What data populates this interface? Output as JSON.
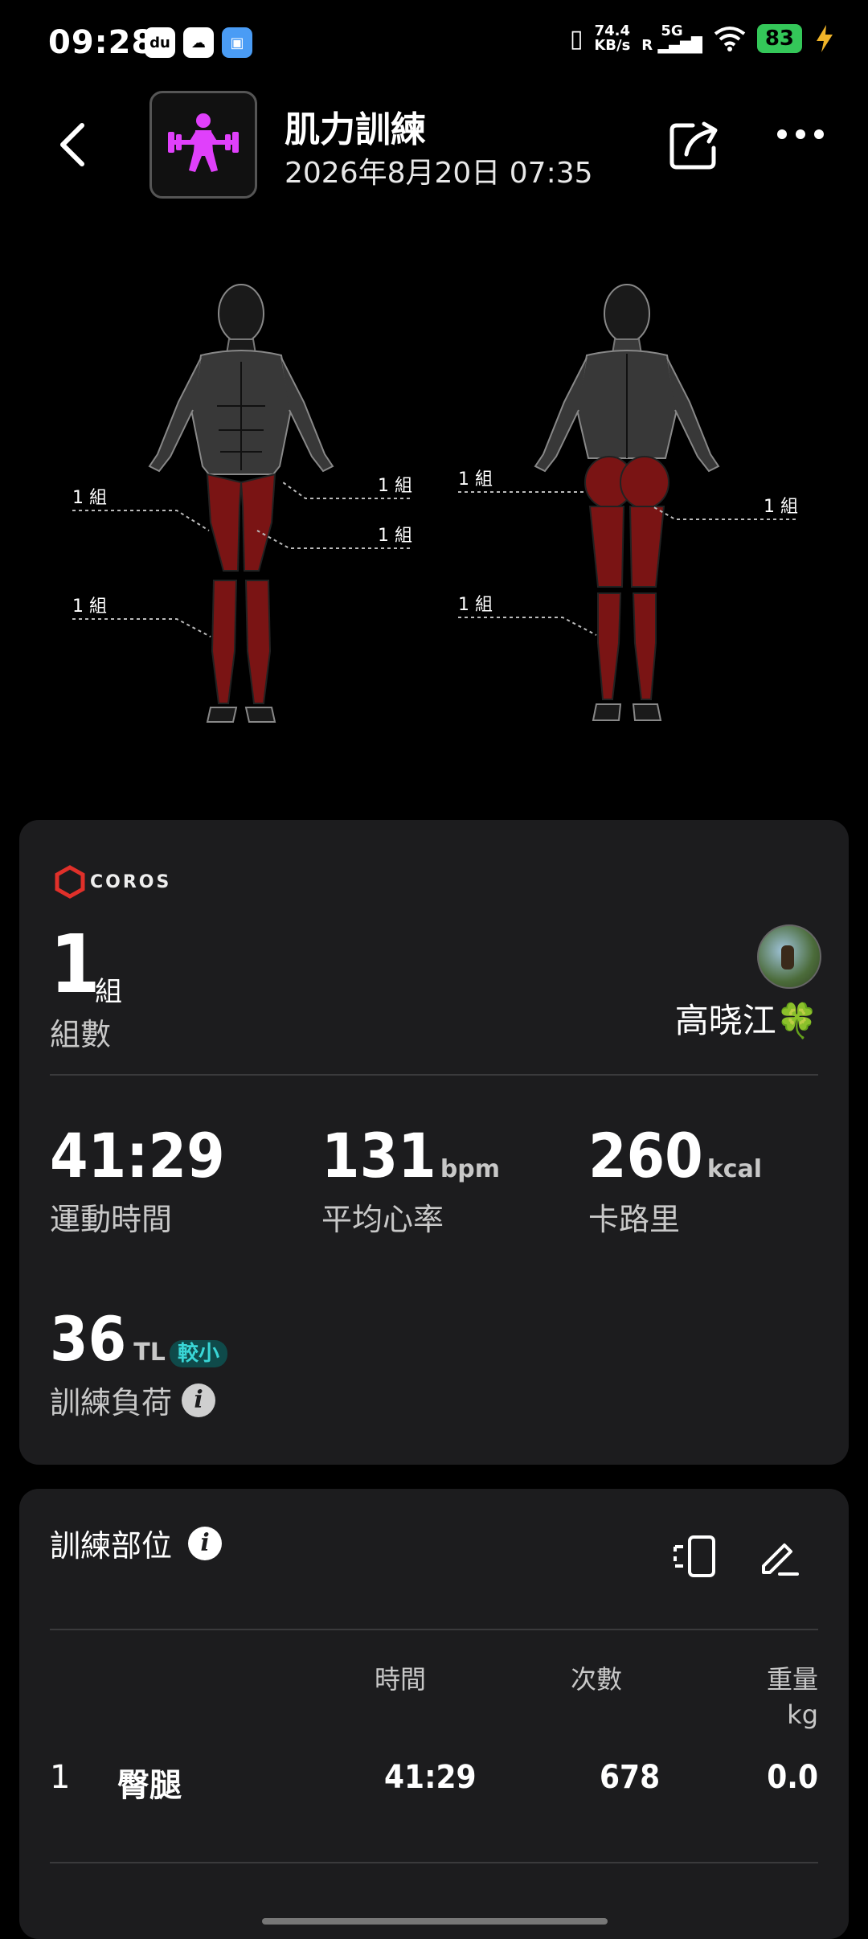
{
  "status_bar": {
    "time": "09:28",
    "app_icons": [
      "du",
      "cloud-app",
      "app"
    ],
    "net_speed_value": "74.4",
    "net_speed_unit": "KB/s",
    "network": "5G",
    "roaming": "R",
    "battery": "83"
  },
  "header": {
    "title": "肌力訓練",
    "datetime": "2026年8月20日 07:35",
    "activity_icon": "weightlifting-icon",
    "accent_color": "#e040fb"
  },
  "muscle_map": {
    "front_labels": [
      "1 組",
      "1 組",
      "1 組",
      "1 組"
    ],
    "back_labels": [
      "1 組",
      "1 組",
      "1 組"
    ],
    "highlight_color": "#7a1414"
  },
  "summary": {
    "brand": "COROS",
    "sets_value": "1",
    "sets_unit": "組",
    "sets_label": "組數",
    "user_name": "高晓江🍀",
    "stats": [
      {
        "value": "41:29",
        "unit": "",
        "label": "運動時間"
      },
      {
        "value": "131",
        "unit": "bpm",
        "label": "平均心率"
      },
      {
        "value": "260",
        "unit": "kcal",
        "label": "卡路里"
      }
    ],
    "load": {
      "value": "36",
      "unit": "TL",
      "badge": "較小",
      "label": "訓練負荷"
    }
  },
  "parts": {
    "title": "訓練部位",
    "columns": {
      "time": "時間",
      "reps": "次數",
      "weight": "重量",
      "weight_unit": "kg"
    },
    "rows": [
      {
        "index": "1",
        "name": "臀腿",
        "time": "41:29",
        "reps": "678",
        "weight": "0.0"
      }
    ]
  }
}
